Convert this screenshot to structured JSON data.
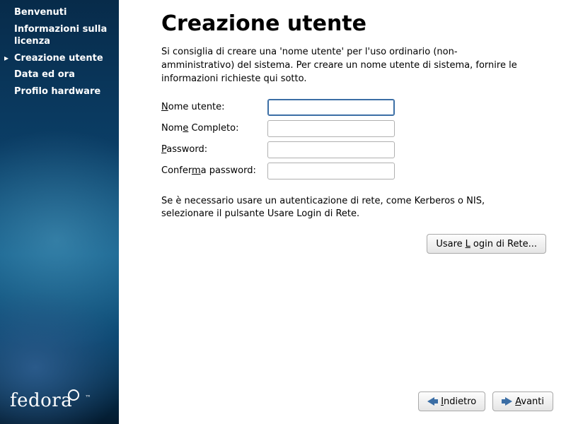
{
  "sidebar": {
    "items": [
      {
        "label": "Benvenuti"
      },
      {
        "label": "Informazioni sulla licenza"
      },
      {
        "label": "Creazione utente"
      },
      {
        "label": "Data ed ora"
      },
      {
        "label": "Profilo hardware"
      }
    ],
    "active_index": 2,
    "brand": "fedora"
  },
  "page": {
    "title": "Creazione utente",
    "intro": "Si consiglia di creare una 'nome utente' per l'uso ordinario (non-amministrativo) del sistema. Per creare un nome utente di sistema, fornire le informazioni richieste qui sotto.",
    "fields": {
      "username": {
        "label_pre": "N",
        "label_u": "o",
        "label_post": "me utente:",
        "value": ""
      },
      "fullname": {
        "label_pre": "Nom",
        "label_u": "e",
        "label_post": " Completo:",
        "value": ""
      },
      "password": {
        "label_pre": "",
        "label_u": "P",
        "label_post": "assword:",
        "value": ""
      },
      "confirm": {
        "label_pre": "Confer",
        "label_u": "m",
        "label_post": "a password:",
        "value": ""
      }
    },
    "net_para": "Se è necessario usare un autenticazione di rete, come Kerberos o NIS, selezionare il pulsante Usare Login di Rete.",
    "net_button": {
      "pre": "Usare ",
      "u": "L",
      "post": "ogin di Rete..."
    }
  },
  "footer": {
    "back": {
      "u": "I",
      "post": "ndietro"
    },
    "next": {
      "u": "A",
      "post": "vanti"
    }
  }
}
